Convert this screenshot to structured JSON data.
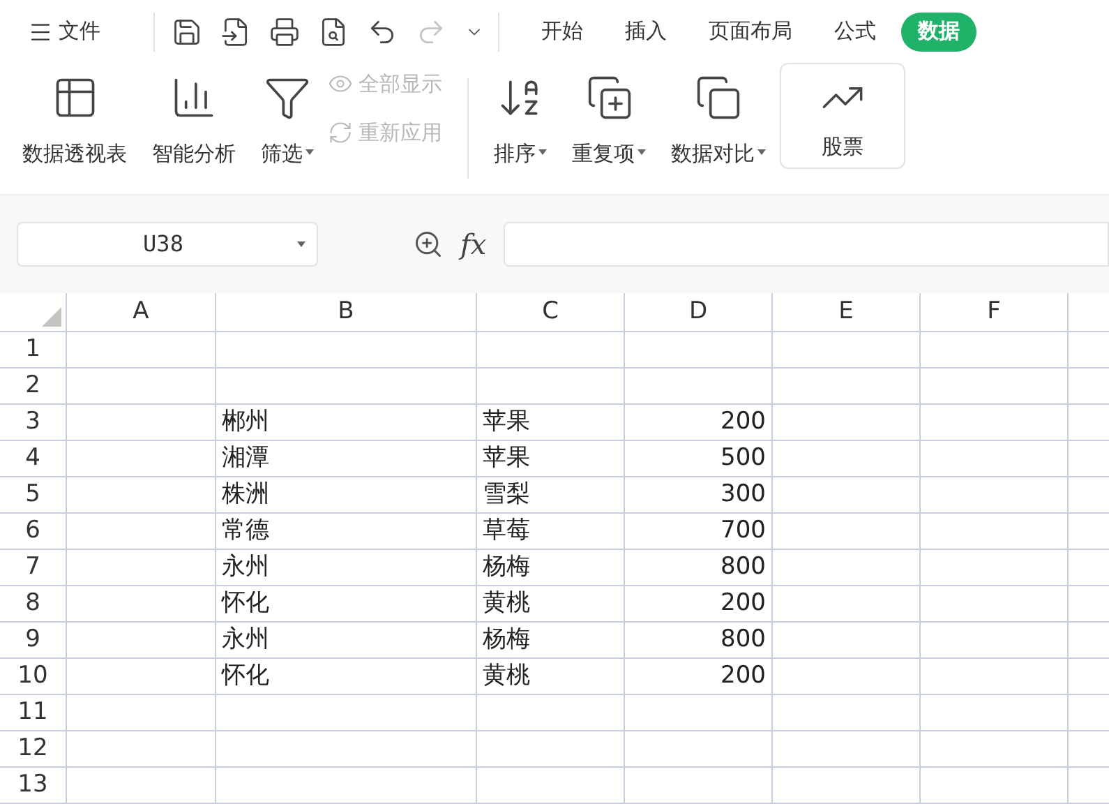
{
  "menu": {
    "label": "文件"
  },
  "quick_access": [
    {
      "kind": "save",
      "disabled": false
    },
    {
      "kind": "export",
      "disabled": false
    },
    {
      "kind": "print",
      "disabled": false
    },
    {
      "kind": "preview",
      "disabled": false
    },
    {
      "kind": "undo",
      "disabled": false
    },
    {
      "kind": "redo",
      "disabled": true
    },
    {
      "kind": "more",
      "disabled": false
    }
  ],
  "tabs": [
    {
      "label": "开始",
      "selected": false
    },
    {
      "label": "插入",
      "selected": false
    },
    {
      "label": "页面布局",
      "selected": false
    },
    {
      "label": "公式",
      "selected": false
    },
    {
      "label": "数据",
      "selected": true
    }
  ],
  "ribbon": [
    {
      "kind": "large",
      "label": "数据透视表",
      "has_menu": false
    },
    {
      "kind": "large",
      "label": "智能分析",
      "has_menu": false
    },
    {
      "kind": "large",
      "label": "筛选",
      "has_menu": true
    },
    {
      "kind": "stack",
      "items": [
        {
          "label": "全部显示",
          "disabled": true
        },
        {
          "label": "重新应用",
          "disabled": true
        }
      ]
    },
    {
      "kind": "separator"
    },
    {
      "kind": "large",
      "label": "排序",
      "has_menu": true
    },
    {
      "kind": "large",
      "label": "重复项",
      "has_menu": true
    },
    {
      "kind": "large",
      "label": "数据对比",
      "has_menu": true
    },
    {
      "kind": "boxed",
      "label": "股票",
      "has_menu": false
    }
  ],
  "formula_bar": {
    "name_box": "U38",
    "fx": "fx"
  },
  "sheet": {
    "columns": [
      "A",
      "B",
      "C",
      "D",
      "E",
      "F"
    ],
    "rows": [
      {
        "number": "1",
        "cells": [
          "",
          "",
          "",
          ""
        ]
      },
      {
        "number": "2",
        "cells": [
          "",
          "",
          "",
          ""
        ]
      },
      {
        "number": "3",
        "cells": [
          "",
          "郴州",
          "苹果",
          "200"
        ]
      },
      {
        "number": "4",
        "cells": [
          "",
          "湘潭",
          "苹果",
          "500"
        ]
      },
      {
        "number": "5",
        "cells": [
          "",
          "株洲",
          "雪梨",
          "300"
        ]
      },
      {
        "number": "6",
        "cells": [
          "",
          "常德",
          "草莓",
          "700"
        ]
      },
      {
        "number": "7",
        "cells": [
          "",
          "永州",
          "杨梅",
          "800"
        ]
      },
      {
        "number": "8",
        "cells": [
          "",
          "怀化",
          "黄桃",
          "200"
        ]
      },
      {
        "number": "9",
        "cells": [
          "",
          "永州",
          "杨梅",
          "800"
        ]
      },
      {
        "number": "10",
        "cells": [
          "",
          "怀化",
          "黄桃",
          "200"
        ]
      },
      {
        "number": "11",
        "cells": [
          "",
          "",
          "",
          ""
        ]
      },
      {
        "number": "12",
        "cells": [
          "",
          "",
          "",
          ""
        ]
      },
      {
        "number": "13",
        "cells": [
          "",
          "",
          "",
          ""
        ]
      }
    ]
  }
}
